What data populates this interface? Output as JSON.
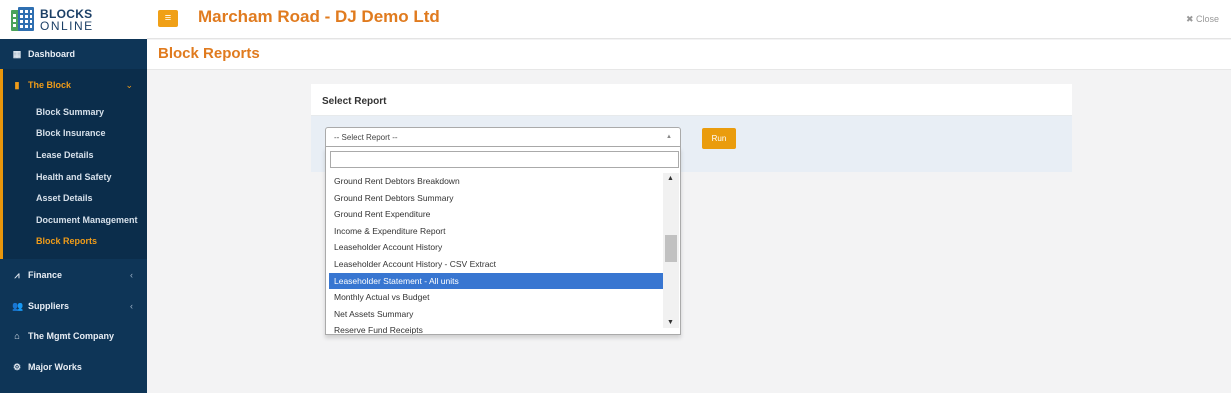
{
  "logo": {
    "line1": "BLOCKS",
    "line2": "ONLINE"
  },
  "sidebar": {
    "items": [
      {
        "icon": "▦",
        "label": "Dashboard"
      },
      {
        "icon": "▮",
        "label": "The Block",
        "arrow": "⌄"
      },
      {
        "icon": "⩘",
        "label": "Finance",
        "arrow": "‹"
      },
      {
        "icon": "👥",
        "label": "Suppliers",
        "arrow": "‹"
      },
      {
        "icon": "⌂",
        "label": "The Mgmt Company"
      },
      {
        "icon": "⚙",
        "label": "Major Works"
      }
    ],
    "sub_items": [
      "Block Summary",
      "Block Insurance",
      "Lease Details",
      "Health and Safety",
      "Asset Details",
      "Document Management",
      "Block Reports"
    ]
  },
  "topbar": {
    "menu_icon": "≡",
    "title": "Marcham Road - DJ Demo Ltd",
    "close_label": "✖ Close"
  },
  "page": {
    "title": "Block Reports"
  },
  "panel": {
    "heading": "Select Report",
    "select_value": "-- Select Report --",
    "select_caret": "▲",
    "run_label": "Run"
  },
  "dropdown": {
    "options": [
      "Ground Rent Debtors Breakdown",
      "Ground Rent Debtors Summary",
      "Ground Rent Expenditure",
      "Income & Expenditure Report",
      "Leaseholder Account History",
      "Leaseholder Account History - CSV Extract",
      "Leaseholder Statement - All units",
      "Monthly Actual vs Budget",
      "Net Assets Summary",
      "Reserve Fund Receipts"
    ],
    "highlighted_index": 6,
    "scroll_up": "▲",
    "scroll_down": "▼"
  },
  "colors": {
    "accent": "#e07b1f",
    "sidebar_bg": "#0e3557",
    "highlight": "#3876d1"
  }
}
